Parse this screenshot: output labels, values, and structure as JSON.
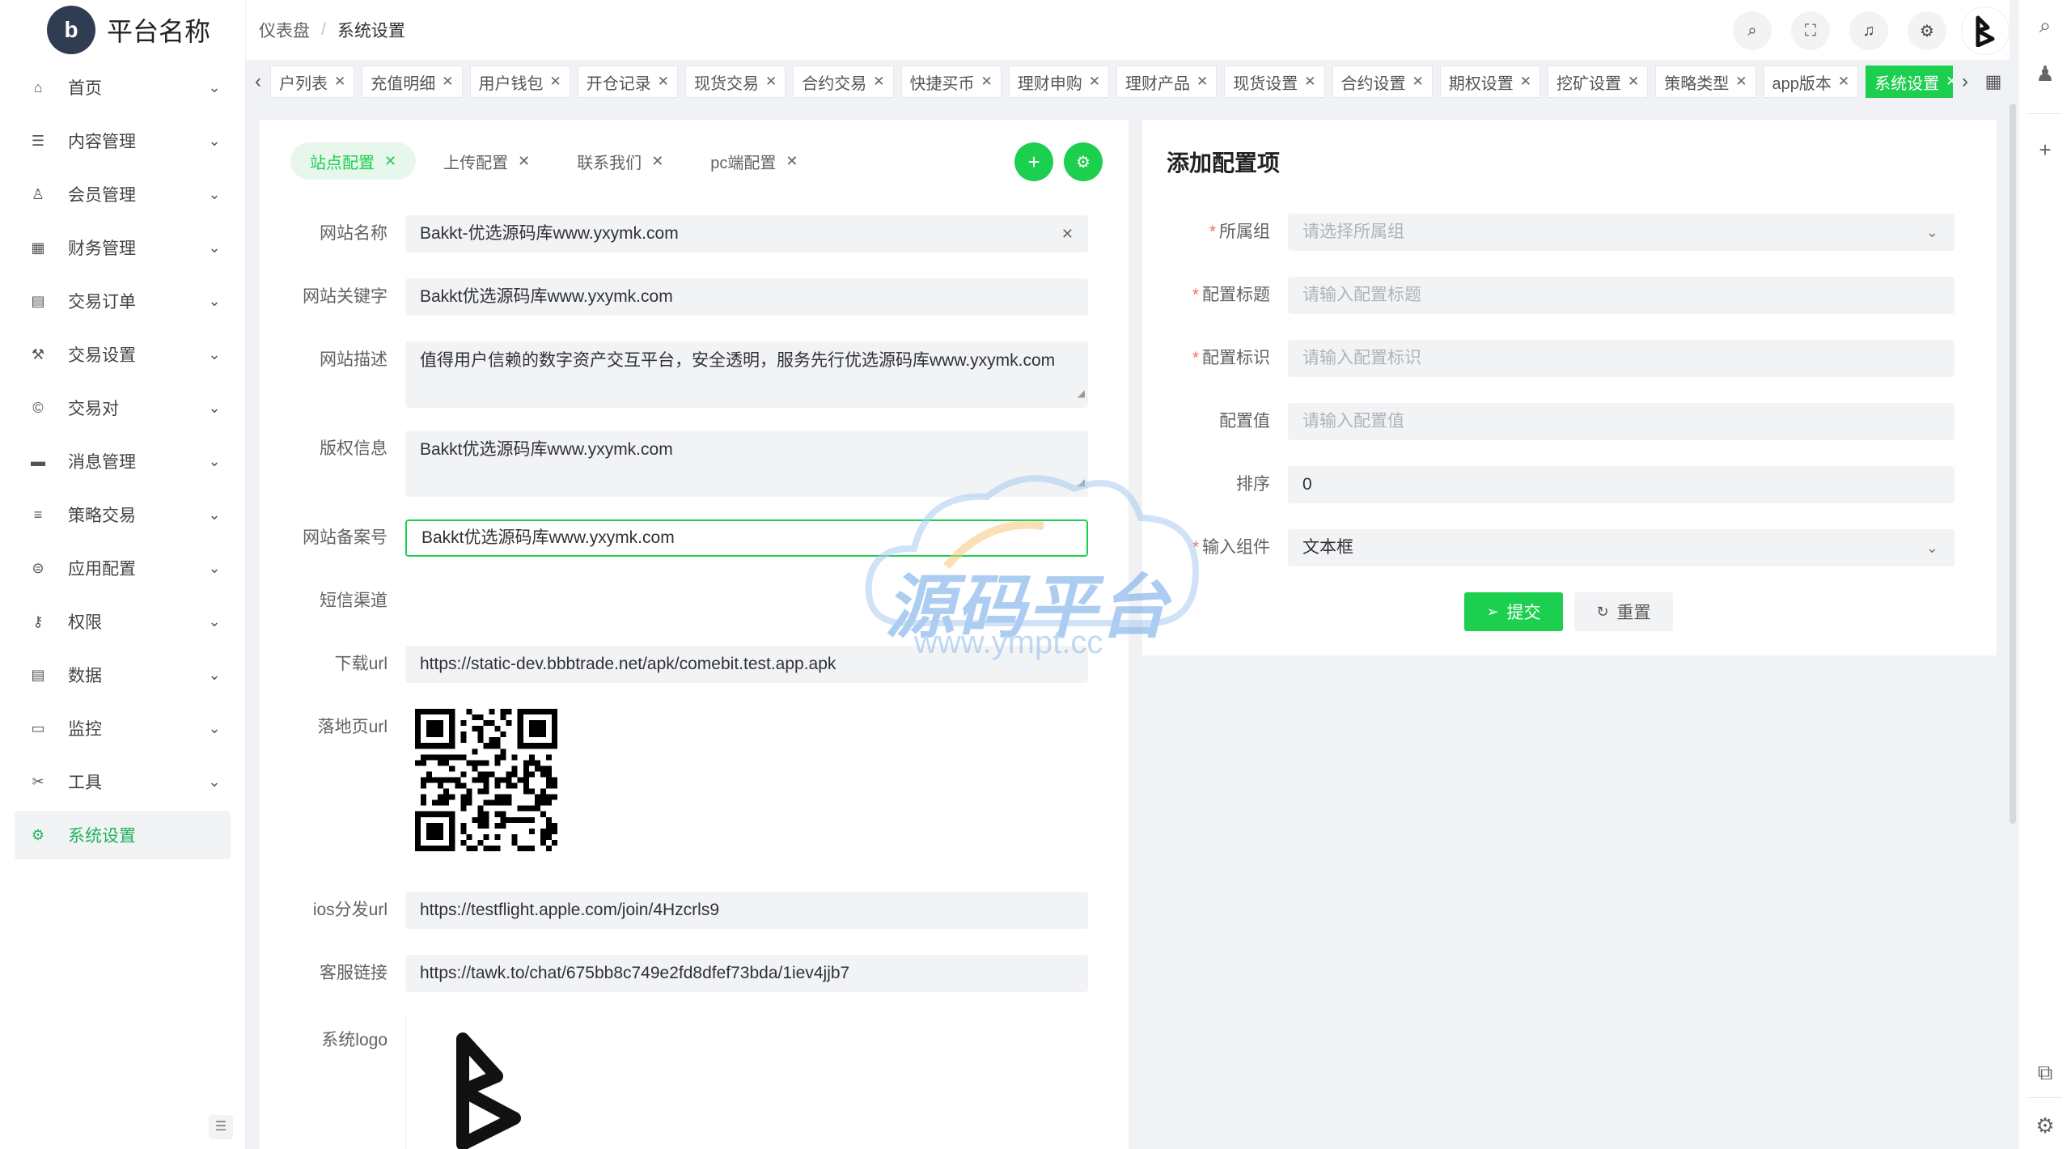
{
  "app": {
    "title": "平台名称",
    "logo_letter": "b"
  },
  "breadcrumb": {
    "home": "仪表盘",
    "current": "系统设置"
  },
  "sidebar": {
    "items": [
      {
        "label": "首页",
        "icon": "home-icon",
        "glyph": "⌂"
      },
      {
        "label": "内容管理",
        "icon": "list-icon",
        "glyph": "☰"
      },
      {
        "label": "会员管理",
        "icon": "user-icon",
        "glyph": "♙"
      },
      {
        "label": "财务管理",
        "icon": "table-icon",
        "glyph": "▦"
      },
      {
        "label": "交易订单",
        "icon": "order-icon",
        "glyph": "▤"
      },
      {
        "label": "交易设置",
        "icon": "wrench-icon",
        "glyph": "⚒"
      },
      {
        "label": "交易对",
        "icon": "copyright-icon",
        "glyph": "©"
      },
      {
        "label": "消息管理",
        "icon": "message-icon",
        "glyph": "▬"
      },
      {
        "label": "策略交易",
        "icon": "menu-icon",
        "glyph": "≡"
      },
      {
        "label": "应用配置",
        "icon": "coins-icon",
        "glyph": "⊜"
      },
      {
        "label": "权限",
        "icon": "user-key-icon",
        "glyph": "⚷"
      },
      {
        "label": "数据",
        "icon": "database-icon",
        "glyph": "▤"
      },
      {
        "label": "监控",
        "icon": "monitor-icon",
        "glyph": "▭"
      },
      {
        "label": "工具",
        "icon": "tools-icon",
        "glyph": "✂"
      },
      {
        "label": "系统设置",
        "icon": "gear-icon",
        "glyph": "⚙",
        "active": true
      }
    ]
  },
  "tags": [
    {
      "label": "户列表"
    },
    {
      "label": "充值明细"
    },
    {
      "label": "用户钱包"
    },
    {
      "label": "开仓记录"
    },
    {
      "label": "现货交易"
    },
    {
      "label": "合约交易"
    },
    {
      "label": "快捷买币"
    },
    {
      "label": "理财申购"
    },
    {
      "label": "理财产品"
    },
    {
      "label": "现货设置"
    },
    {
      "label": "合约设置"
    },
    {
      "label": "期权设置"
    },
    {
      "label": "挖矿设置"
    },
    {
      "label": "策略类型"
    },
    {
      "label": "app版本"
    },
    {
      "label": "系统设置",
      "active": true
    }
  ],
  "config_tabs": [
    {
      "label": "站点配置",
      "active": true
    },
    {
      "label": "上传配置"
    },
    {
      "label": "联系我们"
    },
    {
      "label": "pc端配置"
    }
  ],
  "site_form": {
    "site_name": {
      "label": "网站名称",
      "value": "Bakkt-优选源码库www.yxymk.com"
    },
    "keywords": {
      "label": "网站关键字",
      "value": "Bakkt优选源码库www.yxymk.com"
    },
    "description": {
      "label": "网站描述",
      "value": "值得用户信赖的数字资产交互平台，安全透明，服务先行优选源码库www.yxymk.com"
    },
    "copyright": {
      "label": "版权信息",
      "value": "Bakkt优选源码库www.yxymk.com"
    },
    "icp": {
      "label": "网站备案号",
      "value": "Bakkt优选源码库www.yxymk.com"
    },
    "sms": {
      "label": "短信渠道",
      "value": ""
    },
    "download": {
      "label": "下载url",
      "value": "https://static-dev.bbbtrade.net/apk/comebit.test.app.apk"
    },
    "landing": {
      "label": "落地页url"
    },
    "ios": {
      "label": "ios分发url",
      "value": "https://testflight.apple.com/join/4Hzcrls9"
    },
    "support": {
      "label": "客服链接",
      "value": "https://tawk.to/chat/675bb8c749e2fd8dfef73bda/1iev4jjb7"
    },
    "logo": {
      "label": "系统logo"
    }
  },
  "add_config": {
    "title": "添加配置项",
    "group": {
      "label": "所属组",
      "placeholder": "请选择所属组"
    },
    "title_field": {
      "label": "配置标题",
      "placeholder": "请输入配置标题"
    },
    "key": {
      "label": "配置标识",
      "placeholder": "请输入配置标识"
    },
    "value": {
      "label": "配置值",
      "placeholder": "请输入配置值"
    },
    "sort": {
      "label": "排序",
      "value": "0"
    },
    "component": {
      "label": "输入组件",
      "value": "文本框"
    },
    "submit_label": "提交",
    "reset_label": "重置"
  },
  "watermark": {
    "text": "源码平台",
    "url": "www.ympt.cc"
  },
  "colors": {
    "accent": "#1ccf4f",
    "active_text": "#1fb25a",
    "required": "#f56c6c"
  }
}
